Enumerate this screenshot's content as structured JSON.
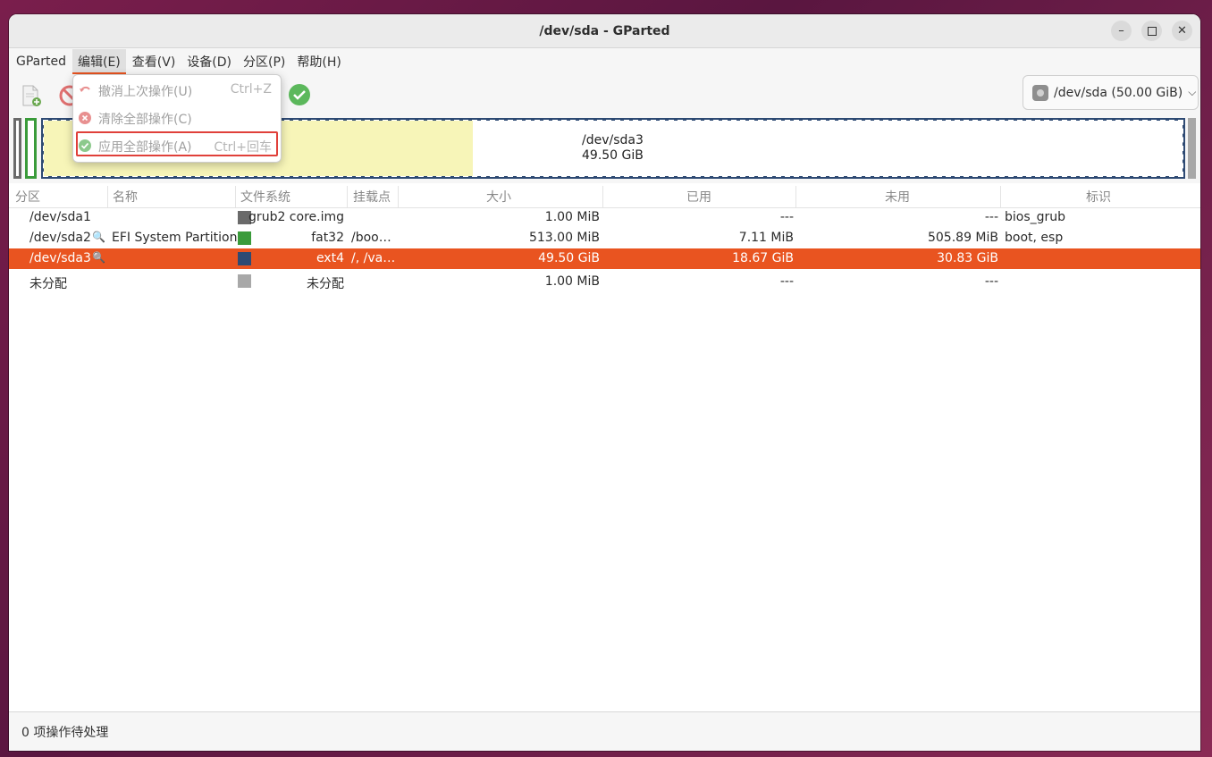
{
  "window": {
    "title": "/dev/sda - GParted"
  },
  "menubar": {
    "items": [
      "GParted",
      "编辑(E)",
      "查看(V)",
      "设备(D)",
      "分区(P)",
      "帮助(H)"
    ],
    "active_index": 1
  },
  "edit_menu": {
    "items": [
      {
        "label": "撤消上次操作(U)",
        "accel": "Ctrl+Z",
        "icon": "undo-icon"
      },
      {
        "label": "清除全部操作(C)",
        "accel": "",
        "icon": "clear-icon"
      },
      {
        "label": "应用全部操作(A)",
        "accel": "Ctrl+回车",
        "icon": "apply-icon"
      }
    ],
    "highlighted_index": 2
  },
  "device_selector": {
    "label": "/dev/sda (50.00 GiB)"
  },
  "disk_map": {
    "sda3_name": "/dev/sda3",
    "sda3_size": "49.50 GiB"
  },
  "columns": [
    "分区",
    "名称",
    "文件系统",
    "挂载点",
    "大小",
    "已用",
    "未用",
    "标识"
  ],
  "rows": [
    {
      "partition": "/dev/sda1",
      "name": "",
      "fs": "grub2 core.img",
      "fs_color": "#6a6a6a",
      "mount": "",
      "size": "1.00 MiB",
      "used": "---",
      "unused": "---",
      "flags": "bios_grub",
      "key": false,
      "selected": false
    },
    {
      "partition": "/dev/sda2",
      "name": "EFI System Partition",
      "fs": "fat32",
      "fs_color": "#3a9b3a",
      "mount": "/boo…",
      "size": "513.00 MiB",
      "used": "7.11 MiB",
      "unused": "505.89 MiB",
      "flags": "boot, esp",
      "key": true,
      "selected": false
    },
    {
      "partition": "/dev/sda3",
      "name": "",
      "fs": "ext4",
      "fs_color": "#2e4a73",
      "mount": "/, /va…",
      "size": "49.50 GiB",
      "used": "18.67 GiB",
      "unused": "30.83 GiB",
      "flags": "",
      "key": true,
      "selected": true
    },
    {
      "partition": "未分配",
      "name": "",
      "fs": "未分配",
      "fs_color": "#a8a8a8",
      "mount": "",
      "size": "1.00 MiB",
      "used": "---",
      "unused": "---",
      "flags": "",
      "key": false,
      "selected": false
    }
  ],
  "statusbar": {
    "text": "0 项操作待处理"
  },
  "colors": {
    "accent": "#e95420",
    "highlight_border": "#e0403a",
    "used_fill": "#f7f5b8"
  }
}
